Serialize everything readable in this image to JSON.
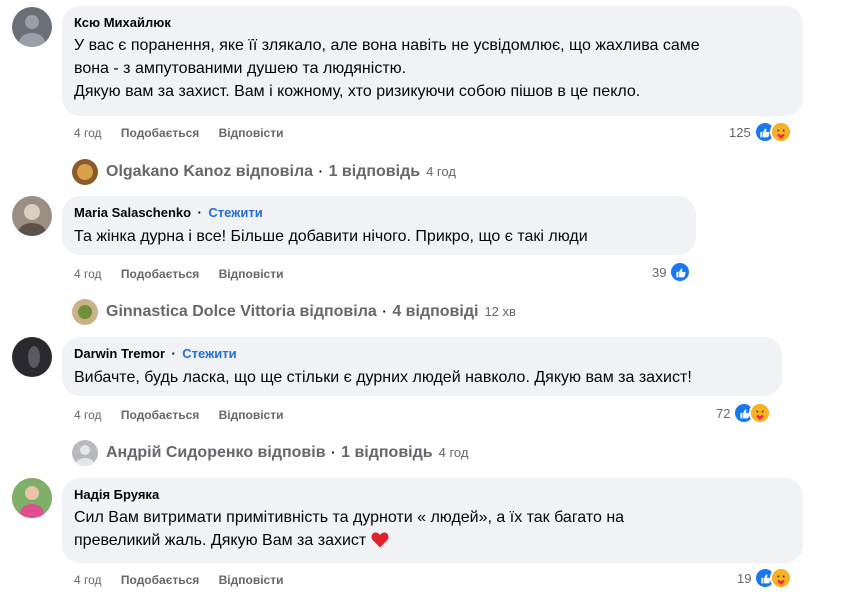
{
  "comments": [
    {
      "author": "Ксю Михайлюк",
      "follow": "",
      "text": "У вас є поранення, яке її злякало, але вона навіть не усвідомлює, що жахлива саме\nвона - з ампутованими душею та людяністю.\nДякую вам за захист. Вам і кожному, хто ризикуючи собою пішов в це пекло.",
      "time": "4 год",
      "like": "Подобається",
      "reply": "Відповісти",
      "reactions": "125",
      "avatar_color": "#6b6f78",
      "replies": {
        "name": "Olgakano Kanoz відповіла",
        "count": "1 відповідь",
        "time": "4 год",
        "avatar_color": "#8a5a2b"
      }
    },
    {
      "author": "Maria Salaschenko",
      "follow": "Стежити",
      "text": "Та жінка дурна і все! Більше добавити нічого. Прикро, що є такі люди",
      "time": "4 год",
      "like": "Подобається",
      "reply": "Відповісти",
      "reactions": "39",
      "avatar_color": "#9a8f82",
      "replies": {
        "name": "Ginnastica Dolce Vittoria відповіла",
        "count": "4 відповіді",
        "time": "12 хв",
        "avatar_color": "#c9b28a"
      }
    },
    {
      "author": "Darwin Tremor",
      "follow": "Стежити",
      "text": "Вибачте, будь ласка, що ще стільки є дурних людей навколо. Дякую вам за захист!",
      "time": "4 год",
      "like": "Подобається",
      "reply": "Відповісти",
      "reactions": "72",
      "avatar_color": "#2a2a2e",
      "replies": {
        "name": "Андрій Сидоренко відповів",
        "count": "1 відповідь",
        "time": "4 год",
        "avatar_color": "#b7b9bc"
      }
    },
    {
      "author": "Надія Бруяка",
      "follow": "",
      "text": "Сил Вам витримати примітивність та дурноти « людей», а їх так багато на\nпревеликий жаль. Дякую Вам за захист",
      "time": "4 год",
      "like": "Подобається",
      "reply": "Відповісти",
      "reactions": "19",
      "avatar_color": "#c95a8a"
    }
  ],
  "icons": {
    "like": "thumbs-up-icon",
    "care": "care-icon",
    "heart": "heart-icon"
  },
  "colors": {
    "bubble": "#f0f2f5",
    "link": "#216fdb",
    "like": "#1877f2",
    "muted": "#65676b"
  }
}
